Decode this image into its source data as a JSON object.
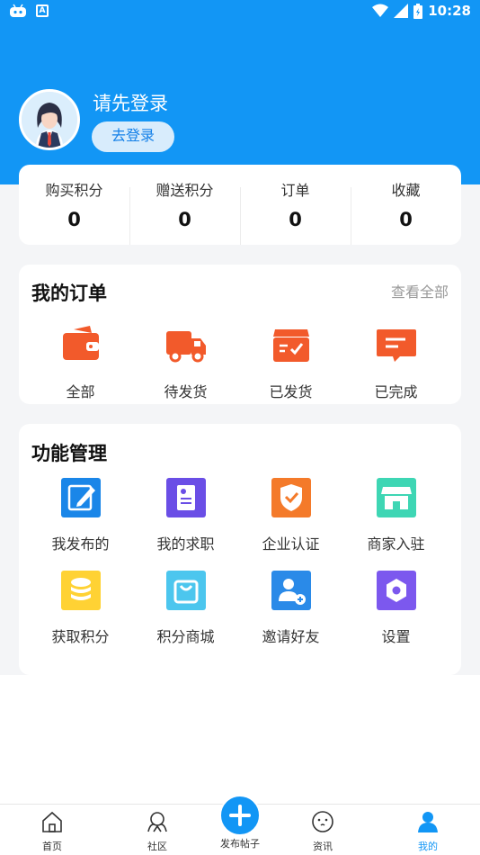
{
  "status_bar": {
    "time": "10:28"
  },
  "profile": {
    "title": "请先登录",
    "login_button": "去登录"
  },
  "stats": [
    {
      "label": "购买积分",
      "value": "0"
    },
    {
      "label": "赠送积分",
      "value": "0"
    },
    {
      "label": "订单",
      "value": "0"
    },
    {
      "label": "收藏",
      "value": "0"
    }
  ],
  "orders": {
    "title": "我的订单",
    "view_all": "查看全部",
    "items": [
      {
        "label": "全部",
        "icon": "wallet-icon"
      },
      {
        "label": "待发货",
        "icon": "truck-icon"
      },
      {
        "label": "已发货",
        "icon": "box-icon"
      },
      {
        "label": "已完成",
        "icon": "message-icon"
      }
    ]
  },
  "functions": {
    "title": "功能管理",
    "items": [
      {
        "label": "我发布的",
        "icon": "edit-icon",
        "color": "#1a86e8"
      },
      {
        "label": "我的求职",
        "icon": "resume-icon",
        "color": "#6a4ee6"
      },
      {
        "label": "企业认证",
        "icon": "shield-icon",
        "color": "#f47a2a"
      },
      {
        "label": "商家入驻",
        "icon": "store-icon",
        "color": "#3ed6b4"
      },
      {
        "label": "获取积分",
        "icon": "coins-icon",
        "color": "#ffd234"
      },
      {
        "label": "积分商城",
        "icon": "bag-icon",
        "color": "#4cc6ee"
      },
      {
        "label": "邀请好友",
        "icon": "add-user-icon",
        "color": "#2a8ae8"
      },
      {
        "label": "设置",
        "icon": "settings-icon",
        "color": "#7c58ee"
      }
    ]
  },
  "nav": {
    "items": [
      {
        "label": "首页",
        "icon": "home-icon"
      },
      {
        "label": "社区",
        "icon": "community-icon"
      },
      {
        "label": "发布帖子",
        "icon": "plus-icon"
      },
      {
        "label": "资讯",
        "icon": "news-icon"
      },
      {
        "label": "我的",
        "icon": "user-icon",
        "active": true
      }
    ]
  },
  "colors": {
    "primary": "#1296f5",
    "order_icon": "#f25a2b"
  }
}
